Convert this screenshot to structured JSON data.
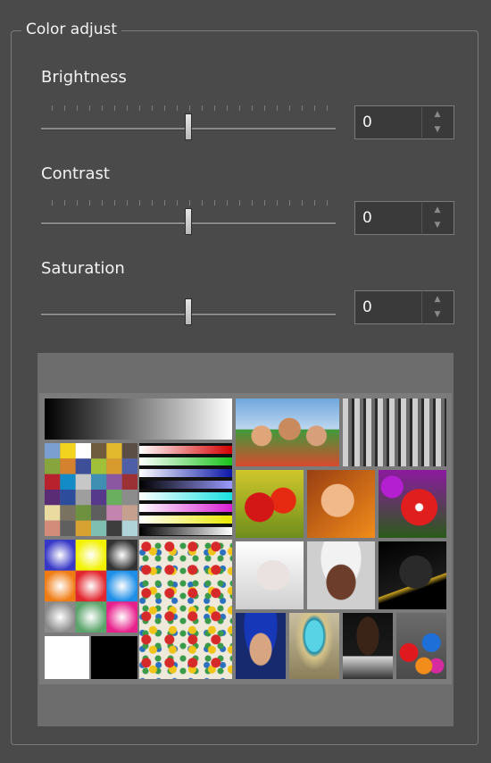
{
  "group_title": "Color adjust",
  "brightness": {
    "label": "Brightness",
    "value": "0"
  },
  "contrast": {
    "label": "Contrast",
    "value": "0"
  },
  "saturation": {
    "label": "Saturation",
    "value": "0"
  },
  "slider_level": 0.5,
  "icons": {
    "spin_up": "triangle-up-icon",
    "spin_down": "triangle-down-icon"
  }
}
